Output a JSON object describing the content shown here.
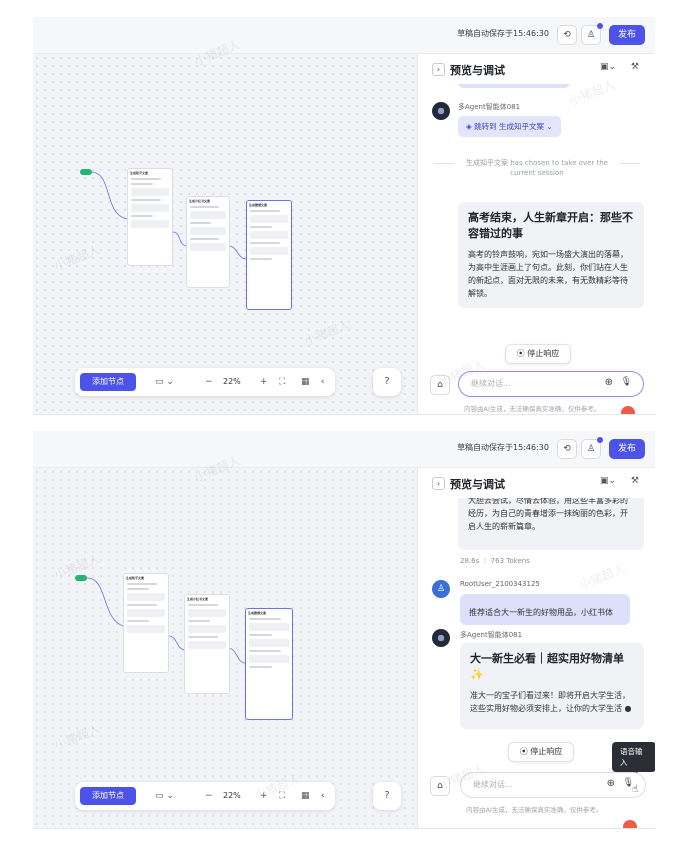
{
  "header": {
    "save_status": "草稿自动保存于15:46:30",
    "publish_label": "发布"
  },
  "panel": {
    "title": "预览与调试"
  },
  "toolbar": {
    "add_node_label": "添加节点",
    "zoom": "22%"
  },
  "chat": {
    "input_placeholder": "继续对话...",
    "stop_label": "停止响应",
    "disclaimer": "内容由AI生成，无法确保真实准确，仅供参考。",
    "voice_tooltip": "语音输入"
  },
  "watermark": "小猪超人",
  "canvas_nodes": [
    {
      "title": "生成知乎文案"
    },
    {
      "title": "生成小红书文案"
    },
    {
      "title": "生成微博文案"
    }
  ],
  "screen1": {
    "agent_name": "多Agent智能体081",
    "jump_label": "跳转到 生成知乎文案",
    "takeover_note": "生成知乎文案 has chosen to take over the current session",
    "answer_title": "高考结束，人生新章开启：那些不容错过的事",
    "answer_text": "高考的铃声鼓响，宛如一场盛大演出的落幕，为高中生涯画上了句点。此刻，你们站在人生的新起点，面对无限的未来，有无数精彩等待解锁。"
  },
  "screen2": {
    "prev_text": "大胆去尝试，尽情去体验，用这些丰富多彩的经历，为自己的青春增添一抹绚丽的色彩，开启人生的崭新篇章。",
    "stats": "28.6s ｜ 763 Tokens",
    "user_name": "RootUser_2100343125",
    "user_message": "推荐适合大一新生的好物用品，小红书体",
    "agent_name": "多Agent智能体081",
    "answer_title": "大一新生必看｜超实用好物清单✨",
    "answer_text": "准大一的宝子们看过来！即将开启大学生活，这些实用好物必须安排上，让你的大学生活 ●"
  }
}
